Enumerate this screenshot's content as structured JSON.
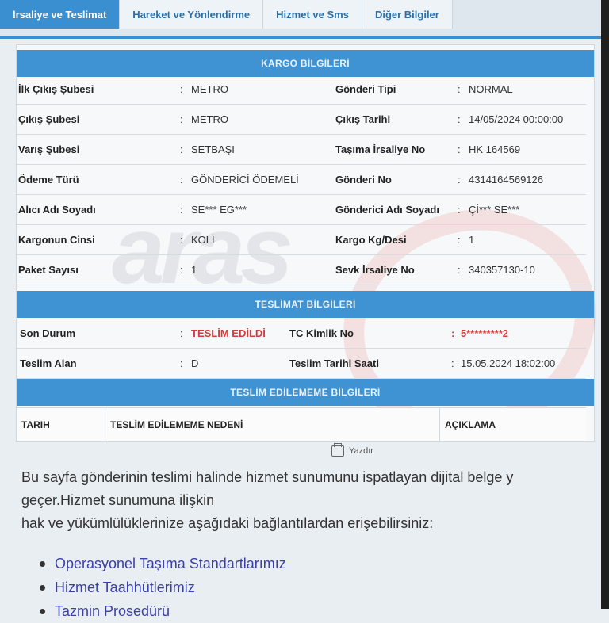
{
  "tabs": [
    "İrsaliye ve Teslimat",
    "Hareket ve Yönlendirme",
    "Hizmet ve Sms",
    "Diğer Bilgiler"
  ],
  "kargo": {
    "title": "KARGO BİLGİLERİ",
    "rows": [
      {
        "l1": "İlk Çıkış Şubesi",
        "v1": "METRO",
        "l2": "Gönderi Tipi",
        "v2": "NORMAL"
      },
      {
        "l1": "Çıkış Şubesi",
        "v1": "METRO",
        "l2": "Çıkış Tarihi",
        "v2": "14/05/2024 00:00:00"
      },
      {
        "l1": "Varış Şubesi",
        "v1": "SETBAŞI",
        "l2": "Taşıma İrsaliye No",
        "v2": "HK 164569"
      },
      {
        "l1": "Ödeme Türü",
        "v1": "GÖNDERİCİ ÖDEMELİ",
        "l2": "Gönderi No",
        "v2": "4314164569126"
      },
      {
        "l1": "Alıcı Adı Soyadı",
        "v1": "SE*** EG***",
        "l2": "Gönderici Adı Soyadı",
        "v2": "Çİ*** SE***"
      },
      {
        "l1": "Kargonun Cinsi",
        "v1": "KOLİ",
        "l2": "Kargo Kg/Desi",
        "v2": "1"
      },
      {
        "l1": "Paket Sayısı",
        "v1": "1",
        "l2": "Sevk İrsaliye No",
        "v2": "340357130-10"
      }
    ]
  },
  "teslimat": {
    "title": "TESLİMAT BİLGİLERİ",
    "rows": [
      {
        "l1": "Son Durum",
        "v1": "TESLİM EDİLDİ",
        "l2": "TC Kimlik No",
        "v2": "5*********2"
      },
      {
        "l1": "Teslim Alan",
        "v1": "D",
        "l2": "Teslim Tarihi Saati",
        "v2": "15.05.2024 18:02:00"
      }
    ]
  },
  "edilememe": {
    "title": "TESLİM EDİLEMEME BİLGİLERİ",
    "columns": [
      "TARIH",
      "TESLİM EDİLEMEME NEDENİ",
      "AÇIKLAMA"
    ]
  },
  "separator": ":",
  "print_label": "Yazdır",
  "body_text": {
    "line1": "Bu sayfa gönderinin teslimi halinde hizmet sunumunu ispatlayan dijital belge y",
    "line2": "geçer.Hizmet sunumuna ilişkin",
    "line3": "hak ve yükümlülüklerinize aşağıdaki bağlantılardan erişebilirsiniz:"
  },
  "links": [
    "Operasyonel Taşıma Standartlarımız",
    "Hizmet Taahhütlerimiz",
    "Tazmin Prosedürü"
  ],
  "colors": {
    "header_blue": "#3f93d3",
    "status_red": "#d23c3c",
    "link": "#3b3fa8"
  }
}
